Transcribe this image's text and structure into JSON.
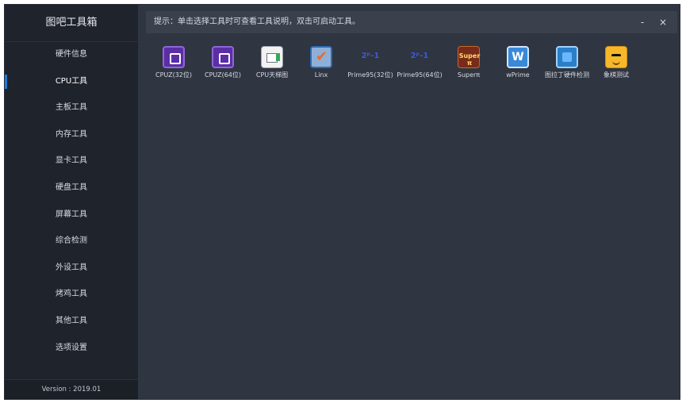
{
  "app": {
    "title": "图吧工具箱",
    "version": "Version : 2019.01"
  },
  "topbar": {
    "hint": "提示：单击选择工具时可查看工具说明，双击可启动工具。",
    "minimize": "-",
    "close": "×"
  },
  "sidebar": {
    "items": [
      {
        "label": "硬件信息"
      },
      {
        "label": "CPU工具"
      },
      {
        "label": "主板工具"
      },
      {
        "label": "内存工具"
      },
      {
        "label": "显卡工具"
      },
      {
        "label": "硬盘工具"
      },
      {
        "label": "屏幕工具"
      },
      {
        "label": "综合检测"
      },
      {
        "label": "外设工具"
      },
      {
        "label": "烤鸡工具"
      },
      {
        "label": "其他工具"
      },
      {
        "label": "选项设置"
      }
    ],
    "active_index": 1
  },
  "tools": [
    {
      "label": "CPUZ(32位)",
      "icon": "cpuz-icon"
    },
    {
      "label": "CPUZ(64位)",
      "icon": "cpuz-icon"
    },
    {
      "label": "CPU天梯图",
      "icon": "cpu-ladder-icon"
    },
    {
      "label": "Linx",
      "icon": "linx-icon"
    },
    {
      "label": "Prime95(32位)",
      "icon": "prime95-icon",
      "icon_text": "2ᵖ-1"
    },
    {
      "label": "Prime95(64位)",
      "icon": "prime95-icon",
      "icon_text": "2ᵖ-1"
    },
    {
      "label": "Superπ",
      "icon": "superpi-icon",
      "icon_text": "Super π"
    },
    {
      "label": "wPrime",
      "icon": "wprime-icon",
      "icon_text": "W"
    },
    {
      "label": "图拉丁硬件检测",
      "icon": "hardware-detect-icon"
    },
    {
      "label": "象棋测试",
      "icon": "chess-test-icon"
    }
  ]
}
